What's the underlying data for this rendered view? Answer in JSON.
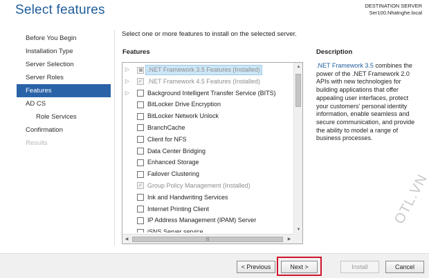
{
  "header": {
    "title": "Select features",
    "destination_label": "DESTINATION SERVER",
    "destination_server": "Ser100.Nhatnghe.local"
  },
  "nav": {
    "items": [
      {
        "label": "Before You Begin"
      },
      {
        "label": "Installation Type"
      },
      {
        "label": "Server Selection"
      },
      {
        "label": "Server Roles"
      },
      {
        "label": "Features"
      },
      {
        "label": "AD CS"
      },
      {
        "label": "Role Services"
      },
      {
        "label": "Confirmation"
      },
      {
        "label": "Results"
      }
    ],
    "active": "Features"
  },
  "main": {
    "intro": "Select one or more features to install on the selected server.",
    "features_header": "Features",
    "description_header": "Description"
  },
  "features": [
    {
      "label": ".NET Framework 3.5 Features (Installed)",
      "checked": "partial",
      "installed": true,
      "expandable": true,
      "selected": true
    },
    {
      "label": ".NET Framework 4.5 Features (Installed)",
      "checked": true,
      "installed": true,
      "expandable": true,
      "selected": false
    },
    {
      "label": "Background Intelligent Transfer Service (BITS)",
      "checked": false,
      "installed": false,
      "expandable": true,
      "selected": false
    },
    {
      "label": "BitLocker Drive Encryption",
      "checked": false,
      "installed": false,
      "expandable": false,
      "selected": false
    },
    {
      "label": "BitLocker Network Unlock",
      "checked": false,
      "installed": false,
      "expandable": false,
      "selected": false
    },
    {
      "label": "BranchCache",
      "checked": false,
      "installed": false,
      "expandable": false,
      "selected": false
    },
    {
      "label": "Client for NFS",
      "checked": false,
      "installed": false,
      "expandable": false,
      "selected": false
    },
    {
      "label": "Data Center Bridging",
      "checked": false,
      "installed": false,
      "expandable": false,
      "selected": false
    },
    {
      "label": "Enhanced Storage",
      "checked": false,
      "installed": false,
      "expandable": false,
      "selected": false
    },
    {
      "label": "Failover Clustering",
      "checked": false,
      "installed": false,
      "expandable": false,
      "selected": false
    },
    {
      "label": "Group Policy Management (Installed)",
      "checked": true,
      "installed": true,
      "expandable": false,
      "selected": false
    },
    {
      "label": "Ink and Handwriting Services",
      "checked": false,
      "installed": false,
      "expandable": false,
      "selected": false
    },
    {
      "label": "Internet Printing Client",
      "checked": false,
      "installed": false,
      "expandable": false,
      "selected": false
    },
    {
      "label": "IP Address Management (IPAM) Server",
      "checked": false,
      "installed": false,
      "expandable": false,
      "selected": false
    },
    {
      "label": "iSNS Server service",
      "checked": false,
      "installed": false,
      "expandable": false,
      "selected": false
    }
  ],
  "description": {
    "feature_name": ".NET Framework 3.5",
    "text": " combines the power of the .NET Framework 2.0 APIs with new technologies for building applications that offer appealing user interfaces, protect your customers' personal identity information, enable seamless and secure communication, and provide the ability to model a range of business processes."
  },
  "buttons": {
    "previous": "< Previous",
    "next": "Next >",
    "install": "Install",
    "cancel": "Cancel"
  },
  "watermark": "OTL.VN",
  "colors": {
    "accent": "#2a62a8",
    "title": "#1f5d9a",
    "highlight_outline": "#d0142c"
  }
}
